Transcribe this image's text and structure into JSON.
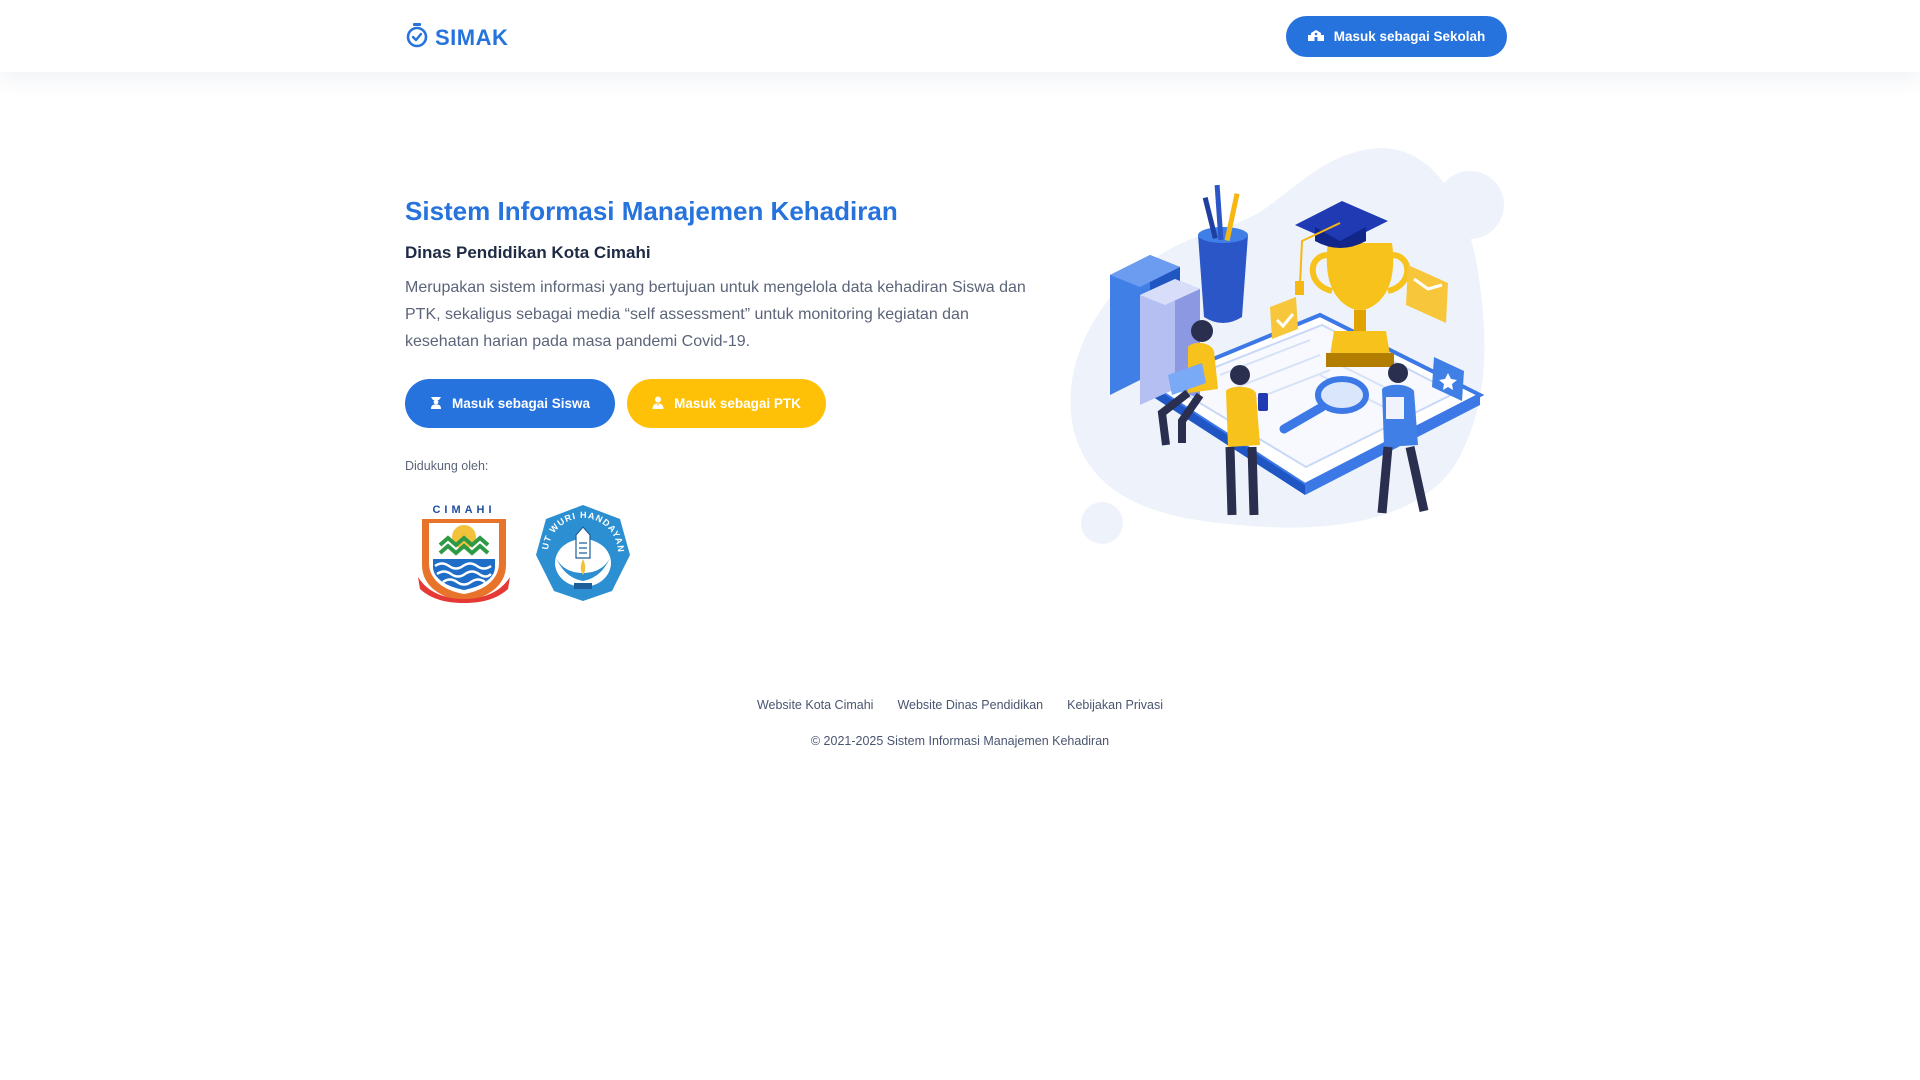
{
  "header": {
    "brand": "SIMAK",
    "school_login_label": "Masuk sebagai Sekolah"
  },
  "hero": {
    "title": "Sistem Informasi Manajemen Kehadiran",
    "subtitle": "Dinas Pendidikan Kota Cimahi",
    "description": "Merupakan sistem informasi yang bertujuan untuk mengelola data kehadiran Siswa dan PTK, sekaligus sebagai media “self assessment” untuk monitoring kegiatan dan kesehatan harian pada masa pandemi Covid-19.",
    "student_login_label": "Masuk sebagai Siswa",
    "ptk_login_label": "Masuk sebagai PTK"
  },
  "support": {
    "label": "Didukung oleh:",
    "logos": [
      {
        "name": "cimahi-city-emblem",
        "text": "CIMAHI"
      },
      {
        "name": "tut-wuri-handayani-emblem",
        "text": "TUT WURI HANDAYANI"
      }
    ]
  },
  "footer": {
    "links": [
      "Website Kota Cimahi",
      "Website Dinas Pendidikan",
      "Kebijakan Privasi"
    ],
    "copyright": "© 2021-2025 Sistem Informasi Manajemen Kehadiran"
  },
  "colors": {
    "primary": "#2673dd",
    "accent": "#ffc107",
    "text_dark": "#1f2a44",
    "text_muted": "#5b6479"
  },
  "icons": {
    "brand": "stopwatch-check-icon",
    "school": "school-building-icon",
    "student": "student-icon",
    "ptk": "teacher-icon"
  }
}
